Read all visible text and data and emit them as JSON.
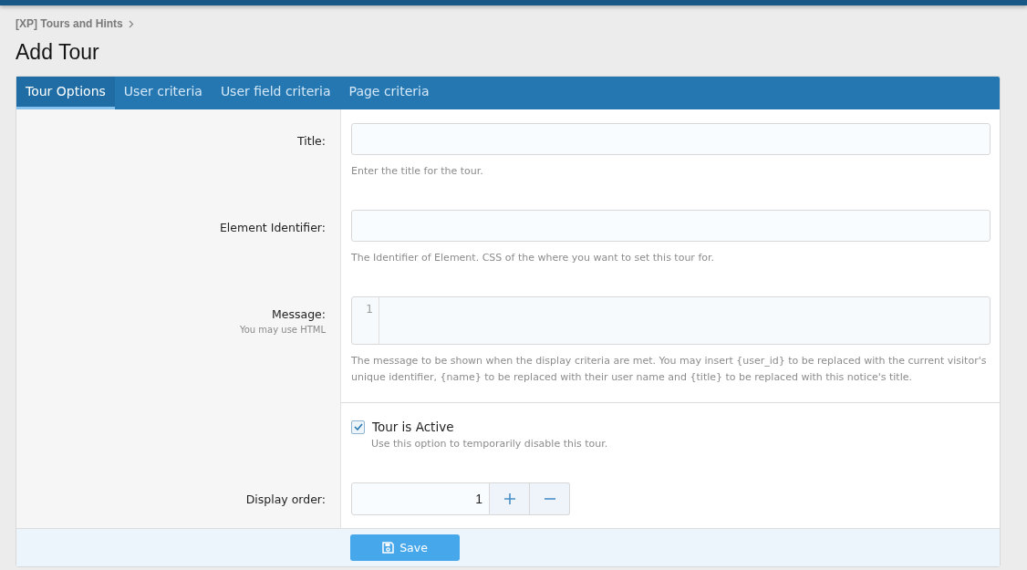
{
  "breadcrumb": [
    {
      "label": "[XP] Tours and Hints"
    }
  ],
  "page_title": "Add Tour",
  "tabs": [
    {
      "label": "Tour Options",
      "selected": true
    },
    {
      "label": "User criteria",
      "selected": false
    },
    {
      "label": "User field criteria",
      "selected": false
    },
    {
      "label": "Page criteria",
      "selected": false
    }
  ],
  "rows": [
    {
      "kind": "text",
      "label": "Title:",
      "hint": "Enter the title for the tour."
    },
    {
      "kind": "text",
      "label": "Element Identifier:",
      "hint": "The Identifier of Element. CSS of the where you want to set this tour for."
    },
    {
      "kind": "code",
      "label": "Message:",
      "sublabel": "You may use HTML",
      "line_number": "1",
      "hint": "The message to be shown when the display criteria are met. You may insert {user_id} to be replaced with the current visitor's unique identifier, {name} to be replaced with their user name and {title} to be replaced with this notice's title."
    },
    {
      "kind": "checkbox",
      "label": "Tour is Active",
      "checked": true,
      "hint": "Use this option to temporarily disable this tour."
    },
    {
      "kind": "number",
      "label": "Display order:",
      "value": "1"
    }
  ],
  "save_button": "Save"
}
